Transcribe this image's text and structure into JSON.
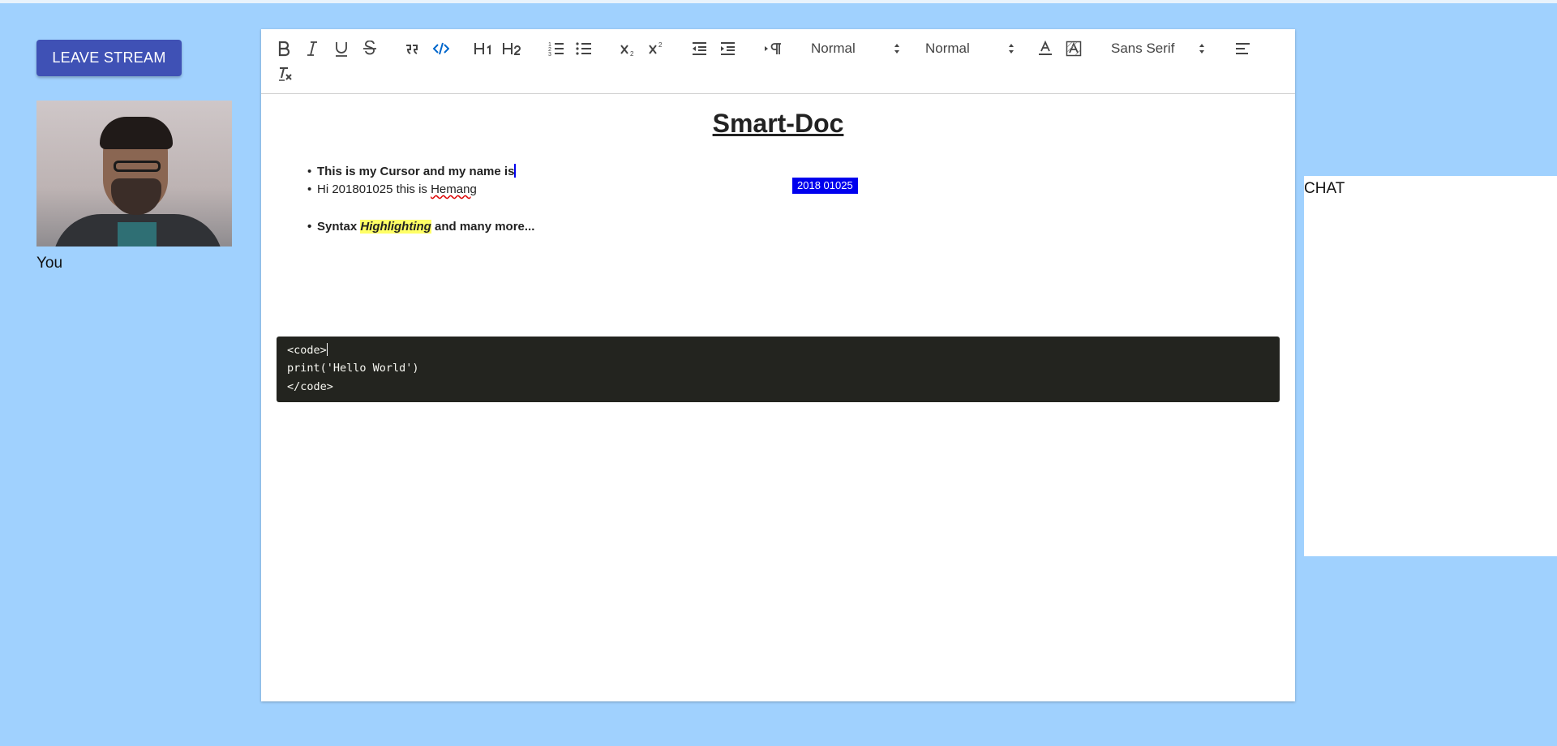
{
  "left": {
    "leave_button": "LEAVE STREAM",
    "self_label": "You"
  },
  "toolbar": {
    "selects": {
      "size": "Normal",
      "header": "Normal",
      "font": "Sans Serif"
    },
    "icons": [
      "bold-icon",
      "italic-icon",
      "underline-icon",
      "strike-icon",
      "blockquote-icon",
      "code-block-icon",
      "h1-icon",
      "h2-icon",
      "ordered-list-icon",
      "bullet-list-icon",
      "subscript-icon",
      "superscript-icon",
      "outdent-icon",
      "indent-icon",
      "rtl-icon",
      "font-color-icon",
      "background-color-icon",
      "align-left-icon",
      "clear-format-icon"
    ],
    "active_color": "#06c"
  },
  "document": {
    "title": "Smart-Doc",
    "cursor_tag": "2018 01025",
    "line1": "This is my Cursor and my name is",
    "line2_prefix": "Hi 201801025 this is ",
    "line2_name": "Hemang",
    "line3_a": "Syntax ",
    "line3_hl": "Highlighting",
    "line3_b": " and many more...",
    "code": [
      "<code>",
      "print('Hello World')",
      "</code>"
    ]
  },
  "chat": {
    "title": "CHAT"
  },
  "colors": {
    "background": "#a0d1fe",
    "button": "#3f51b5",
    "cursor": "#0000ee",
    "highlight": "#ffff66",
    "code_bg": "#23241f"
  }
}
